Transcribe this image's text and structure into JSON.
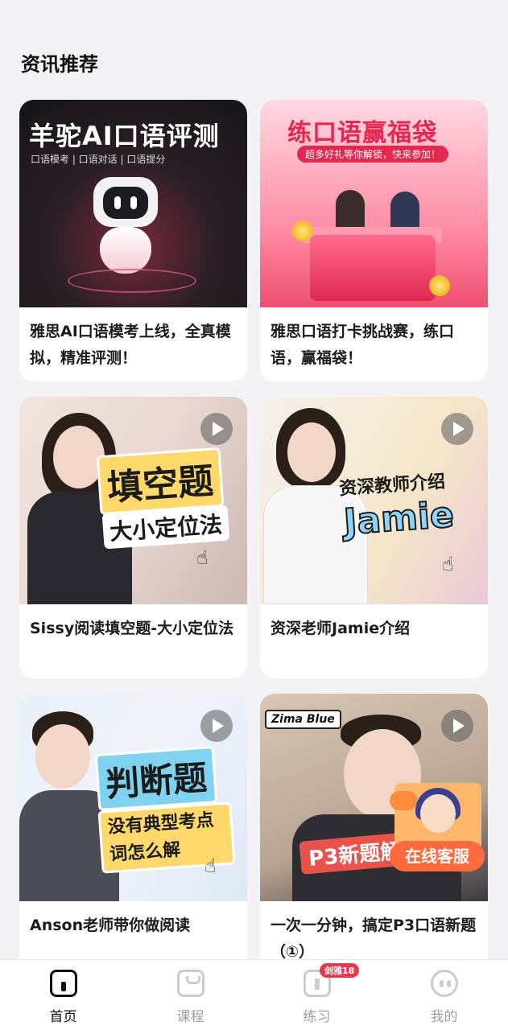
{
  "section": {
    "title": "资讯推荐"
  },
  "cards": [
    {
      "title": "雅思AI口语模考上线，全真模拟，精准评测！",
      "thumb_headline": "羊驼AI口语评测",
      "thumb_sub": "口语模考 | 口语对话 | 口语提分"
    },
    {
      "title": "雅思口语打卡挑战赛，练口语，赢福袋！",
      "thumb_headline": "练口语赢福袋",
      "thumb_sub": "超多好礼等你解锁，快来参加！"
    },
    {
      "title": "Sissy阅读填空题-大小定位法",
      "thumb_headline": "填空题",
      "thumb_sub": "大小定位法"
    },
    {
      "title": "资深老师Jamie介绍",
      "thumb_headline": "资深教师介绍",
      "thumb_sub": "Jamie"
    },
    {
      "title": "Anson老师带你做阅读",
      "thumb_headline": "判断题",
      "thumb_sub": "没有典型考点词怎么解"
    },
    {
      "title": "一次一分钟，搞定P3口语新题 （①）",
      "thumb_tag": "Zima Blue",
      "thumb_sub": "P3新题解"
    }
  ],
  "support_fab": {
    "label": "在线客服"
  },
  "tabbar": {
    "tabs": [
      {
        "label": "首页",
        "icon": "home-icon",
        "active": true
      },
      {
        "label": "课程",
        "icon": "course-icon",
        "active": false
      },
      {
        "label": "练习",
        "icon": "practice-icon",
        "active": false,
        "badge": "剑雅18"
      },
      {
        "label": "我的",
        "icon": "mine-icon",
        "active": false
      }
    ]
  },
  "colors": {
    "background": "#f3f3f5",
    "badge": "#e8384f",
    "support": "#ff6a3d",
    "tab_inactive": "#9aa0a8"
  }
}
